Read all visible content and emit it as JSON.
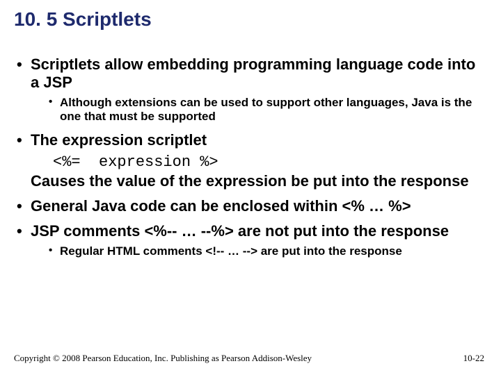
{
  "title": "10. 5 Scriptlets",
  "bullets": {
    "b1": "Scriptlets allow embedding programming language code into a JSP",
    "b1_sub1": "Although extensions can be used to support other languages, Java is the one that must be supported",
    "b2": "The expression scriptlet",
    "b2_code": "<%=  expression %>",
    "b2_cont": "Causes the value of the expression be put into the response",
    "b3": "General Java code can be enclosed within <% … %>",
    "b4": "JSP comments <%-- … --%> are not put into the response",
    "b4_sub1": "Regular HTML comments <!-- … --> are put into the response"
  },
  "footer": {
    "copyright": "Copyright © 2008 Pearson Education, Inc. Publishing as Pearson Addison-Wesley",
    "pagenum": "10-22"
  }
}
